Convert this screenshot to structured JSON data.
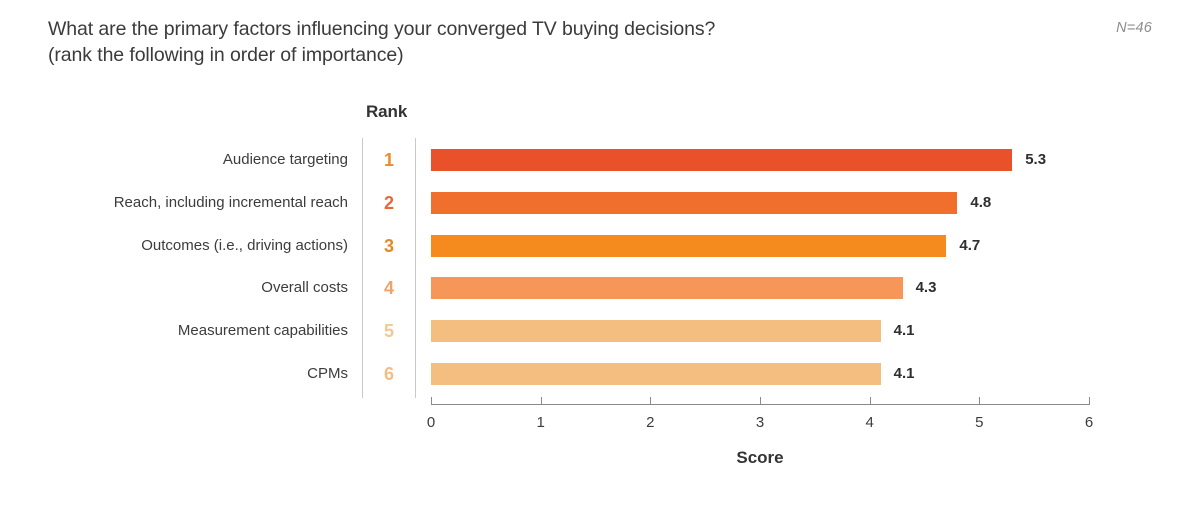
{
  "header": {
    "title_line1": "What are the primary factors influencing your converged TV buying decisions?",
    "title_line2": "(rank the following in order of importance)",
    "sample_size": "N=46"
  },
  "rank_column_header": "Rank",
  "chart_data": {
    "type": "bar",
    "orientation": "horizontal",
    "title": "What are the primary factors influencing your converged TV buying decisions? (rank the following in order of importance)",
    "subtitle": "",
    "xlabel": "Score",
    "ylabel": "",
    "xlim": [
      0,
      6
    ],
    "xticks": [
      "0",
      "1",
      "2",
      "3",
      "4",
      "5",
      "6"
    ],
    "grid": false,
    "legend": null,
    "annotation": "N=46",
    "categories": [
      "Audience targeting",
      "Reach, including incremental reach",
      "Outcomes (i.e., driving actions)",
      "Overall costs",
      "Measurement capabilities",
      "CPMs"
    ],
    "ranks": [
      "1",
      "2",
      "3",
      "4",
      "5",
      "6"
    ],
    "values": [
      5.3,
      4.8,
      4.7,
      4.3,
      4.1,
      4.1
    ],
    "value_labels": [
      "5.3",
      "4.8",
      "4.7",
      "4.3",
      "4.1",
      "4.1"
    ],
    "bar_colors": [
      "#E8512A",
      "#F06F2C",
      "#F58A1E",
      "#F79659",
      "#F3BE7F",
      "#F3BE7F"
    ],
    "rank_colors": [
      "#EF8A2B",
      "#E8673A",
      "#E08A2E",
      "#F0A368",
      "#F2C894",
      "#F2BE84"
    ]
  },
  "colors": {
    "text_primary": "#3c3c3c",
    "text_muted": "#8d8d8d",
    "axis": "#8a8a8a",
    "rule": "#c9c9c9",
    "background": "#ffffff"
  }
}
